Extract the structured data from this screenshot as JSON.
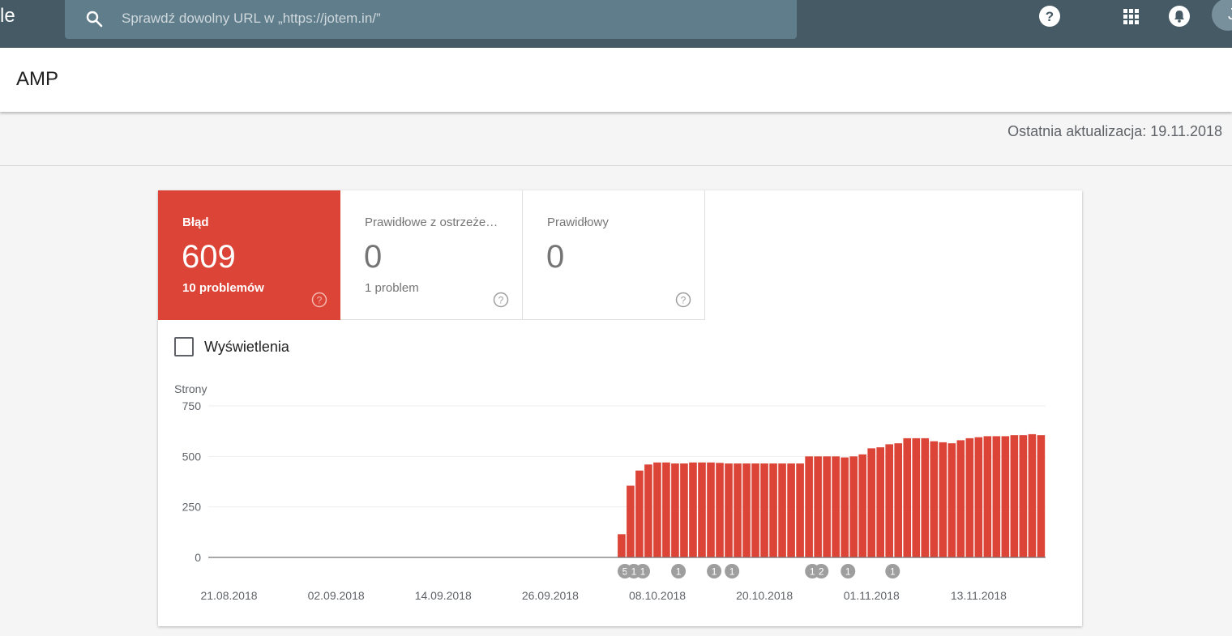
{
  "topbar": {
    "logo_fragment": "le",
    "search_placeholder": "Sprawdź dowolny URL w „https://jotem.in/”",
    "avatar_letter": "J"
  },
  "page": {
    "title": "AMP",
    "last_update": "Ostatnia aktualizacja: 19.11.2018"
  },
  "tiles": [
    {
      "label": "Błąd",
      "count": "609",
      "sub": "10 problemów"
    },
    {
      "label": "Prawidłowe z ostrzeżeniami",
      "count": "0",
      "sub": "1 problem"
    },
    {
      "label": "Prawidłowy",
      "count": "0",
      "sub": ""
    }
  ],
  "checkbox": {
    "label": "Wyświetlenia"
  },
  "colors": {
    "error": "#db4437",
    "topbar": "#455a64",
    "search": "#607d8b"
  },
  "chart_data": {
    "type": "bar",
    "ylabel": "Strony",
    "ylim": [
      0,
      750
    ],
    "yticks": [
      "750",
      "500",
      "250",
      "0"
    ],
    "x_tick_labels": [
      "21.08.2018",
      "02.09.2018",
      "14.09.2018",
      "26.09.2018",
      "08.10.2018",
      "20.10.2018",
      "01.11.2018",
      "13.11.2018"
    ],
    "bar_color": "#db4437",
    "values": [
      115,
      355,
      430,
      460,
      470,
      470,
      465,
      465,
      470,
      470,
      470,
      468,
      465,
      465,
      465,
      465,
      465,
      465,
      465,
      465,
      465,
      500,
      500,
      500,
      500,
      495,
      500,
      510,
      540,
      545,
      560,
      565,
      590,
      590,
      590,
      575,
      570,
      565,
      580,
      590,
      595,
      600,
      600,
      600,
      605,
      605,
      610,
      605
    ],
    "annotations": [
      {
        "label": "5",
        "index": 0
      },
      {
        "label": "1",
        "index": 1
      },
      {
        "label": "1",
        "index": 2
      },
      {
        "label": "1",
        "index": 6
      },
      {
        "label": "1",
        "index": 10
      },
      {
        "label": "1",
        "index": 12
      },
      {
        "label": "1",
        "index": 21
      },
      {
        "label": "2",
        "index": 22
      },
      {
        "label": "1",
        "index": 25
      },
      {
        "label": "1",
        "index": 30
      }
    ]
  }
}
